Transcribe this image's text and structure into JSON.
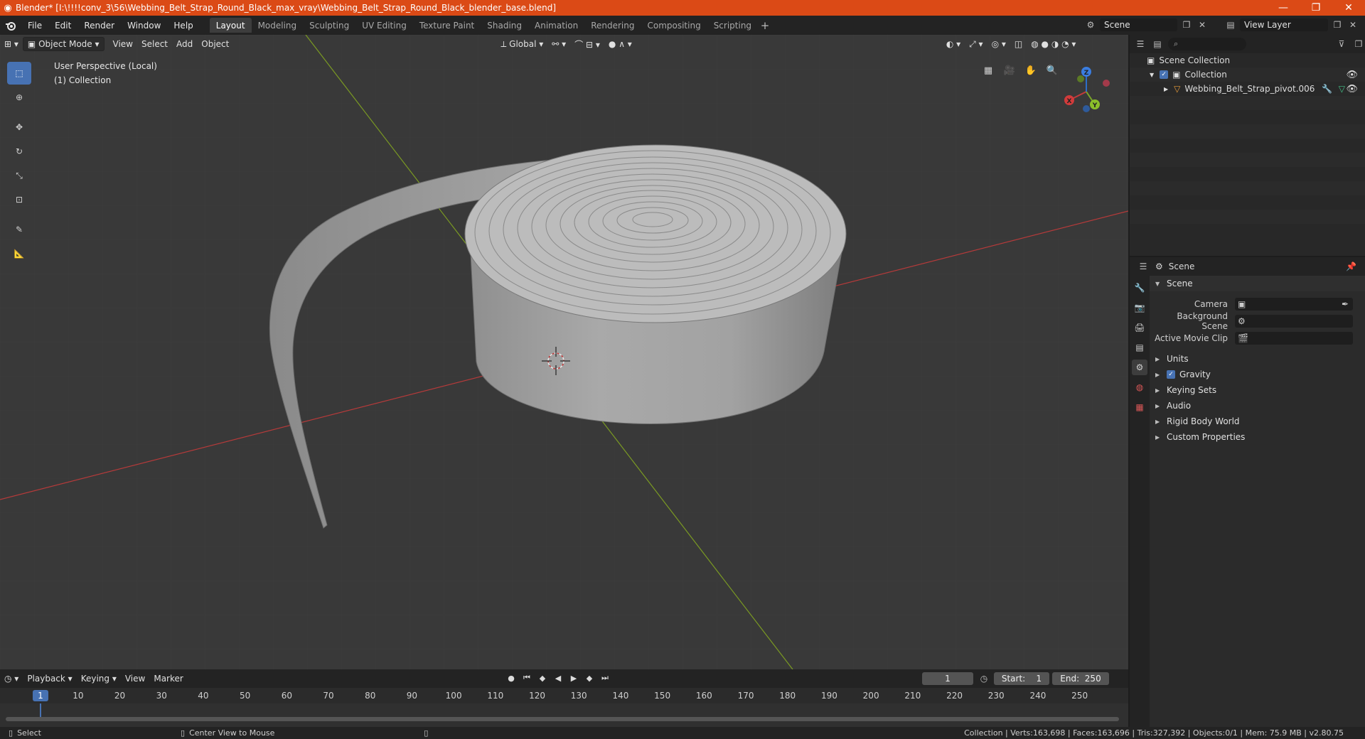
{
  "window": {
    "title": "Blender* [I:\\!!!!conv_3\\56\\Webbing_Belt_Strap_Round_Black_max_vray\\Webbing_Belt_Strap_Round_Black_blender_base.blend]",
    "minimize": "—",
    "maximize": "❐",
    "close": "✕"
  },
  "menu": [
    "File",
    "Edit",
    "Render",
    "Window",
    "Help"
  ],
  "workspaces": [
    "Layout",
    "Modeling",
    "Sculpting",
    "UV Editing",
    "Texture Paint",
    "Shading",
    "Animation",
    "Rendering",
    "Compositing",
    "Scripting"
  ],
  "active_workspace": "Layout",
  "scene_name": "Scene",
  "view_layer": "View Layer",
  "viewport": {
    "mode": "Object Mode",
    "menus": [
      "View",
      "Select",
      "Add",
      "Object"
    ],
    "transform_orientation": "Global",
    "info_line1": "User Perspective (Local)",
    "info_line2": "(1) Collection",
    "gizmo": {
      "x": "X",
      "y": "Y",
      "z": "Z"
    }
  },
  "timeline": {
    "menus": [
      "Playback",
      "Keying",
      "View",
      "Marker"
    ],
    "current_frame": "1",
    "start_label": "Start:",
    "start": "1",
    "end_label": "End:",
    "end": "250",
    "ruler": [
      "1",
      "10",
      "20",
      "30",
      "40",
      "50",
      "60",
      "70",
      "80",
      "90",
      "100",
      "110",
      "120",
      "130",
      "140",
      "150",
      "160",
      "170",
      "180",
      "190",
      "200",
      "210",
      "220",
      "230",
      "240",
      "250"
    ]
  },
  "statusbar": {
    "select": "Select",
    "center_view": "Center View to Mouse",
    "stats": "Collection | Verts:163,698 | Faces:163,696 | Tris:327,392 | Objects:0/1 | Mem: 75.9 MB | v2.80.75"
  },
  "outliner": {
    "root": "Scene Collection",
    "collection": "Collection",
    "object": "Webbing_Belt_Strap_pivot.006"
  },
  "properties": {
    "header": "Scene",
    "panel_scene": "Scene",
    "camera_label": "Camera",
    "bg_scene_label": "Background Scene",
    "movie_clip_label": "Active Movie Clip",
    "panels": [
      "Units",
      "Gravity",
      "Keying Sets",
      "Audio",
      "Rigid Body World",
      "Custom Properties"
    ]
  },
  "colors": {
    "titlebar": "#db4a16",
    "accent": "#4772b3",
    "viewport_bg": "#393939",
    "axis_x": "#b53a3a",
    "axis_y": "#7a9a23"
  }
}
